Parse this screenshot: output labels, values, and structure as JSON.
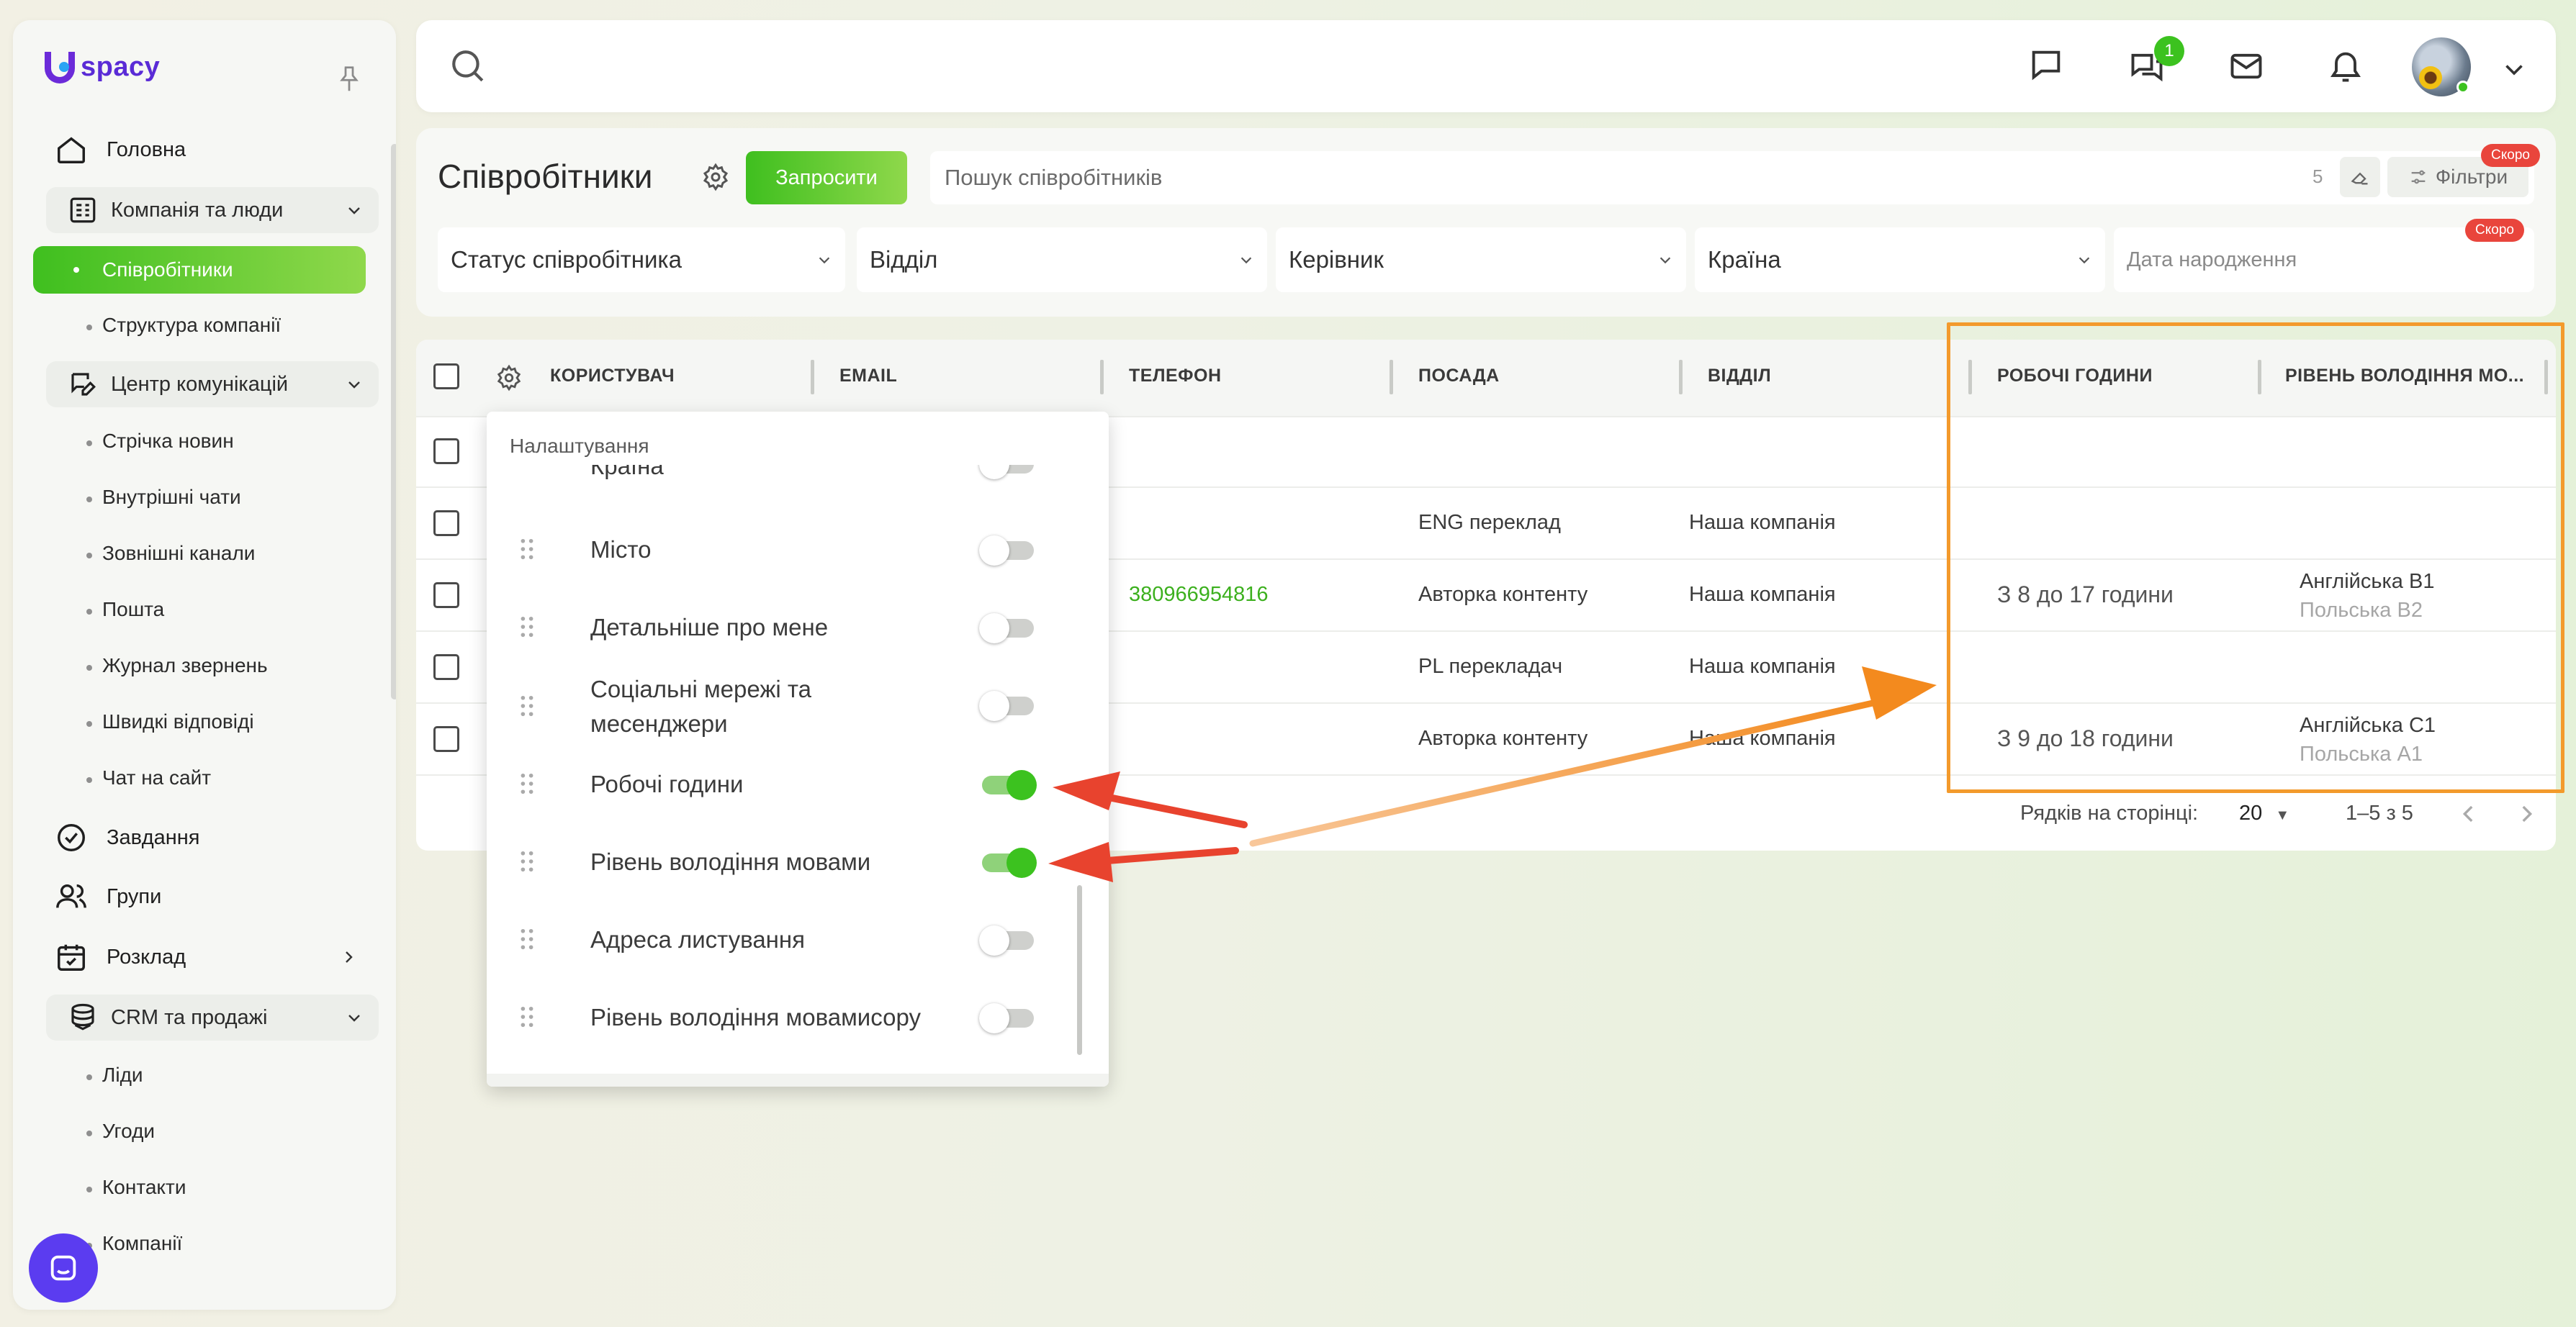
{
  "app": {
    "logo_text": "spacy",
    "brand_color": "#5a2bd6",
    "accent_color": "#3cc21f",
    "highlight_color": "#f39a2c",
    "arrow_color": "#e8432e"
  },
  "sidebar": {
    "items": [
      {
        "label": "Головна",
        "icon": "home-icon",
        "type": "item"
      },
      {
        "label": "Компанія та люди",
        "icon": "building-icon",
        "type": "group",
        "expanded": true,
        "children": [
          "Співробітники",
          "Структура компанії"
        ],
        "active_child": "Співробітники"
      },
      {
        "label": "Центр комунікацій",
        "icon": "chat-edit-icon",
        "type": "group",
        "expanded": true,
        "children": [
          "Стрічка новин",
          "Внутрішні чати",
          "Зовнішні канали",
          "Пошта",
          "Журнал звернень",
          "Швидкі відповіді",
          "Чат на сайт"
        ]
      },
      {
        "label": "Завдання",
        "icon": "check-circle-icon",
        "type": "item"
      },
      {
        "label": "Групи",
        "icon": "users-icon",
        "type": "item"
      },
      {
        "label": "Розклад",
        "icon": "calendar-icon",
        "type": "item-chevron"
      },
      {
        "label": "CRM та продажі",
        "icon": "database-icon",
        "type": "group",
        "expanded": true,
        "children": [
          "Ліди",
          "Угоди",
          "Контакти",
          "Компанії"
        ]
      }
    ]
  },
  "topbar": {
    "chat_badge": "1"
  },
  "header": {
    "title": "Співробітники",
    "invite_label": "Запросити",
    "search_placeholder": "Пошук співробітників",
    "result_count": "5",
    "filters_label": "Фільтри",
    "soon_label": "Скоро",
    "filter_selects": [
      "Статус співробітника",
      "Відділ",
      "Керівник",
      "Країна"
    ],
    "birthday_placeholder": "Дата народження"
  },
  "table": {
    "columns": [
      "КОРИСТУВАЧ",
      "EMAIL",
      "ТЕЛЕФОН",
      "ПОСАДА",
      "ВІДДІЛ",
      "РОБОЧІ ГОДИНИ",
      "РІВЕНЬ ВОЛОДІННЯ МО..."
    ],
    "rows": [
      {
        "phone": "",
        "position": "",
        "department": "",
        "hours": "",
        "lang1": "",
        "lang2": ""
      },
      {
        "phone": "",
        "position": "ENG переклад",
        "department": "Наша компанія",
        "hours": "",
        "lang1": "",
        "lang2": ""
      },
      {
        "phone": "380966954816",
        "position": "Авторка контенту",
        "department": "Наша компанія",
        "hours": "З 8 до 17 години",
        "lang1": "Англійська В1",
        "lang2": "Польська В2"
      },
      {
        "phone": "",
        "position": "PL перекладач",
        "department": "Наша компанія",
        "hours": "",
        "lang1": "",
        "lang2": ""
      },
      {
        "phone": "",
        "position": "Авторка контенту",
        "department": "Наша компанія",
        "hours": "З 9 до 18 години",
        "lang1": "Англійська С1",
        "lang2": "Польська А1"
      }
    ],
    "pager": {
      "rows_label": "Рядків на сторінці:",
      "rows_value": "20",
      "range": "1–5 з 5"
    }
  },
  "settings_popup": {
    "title": "Налаштування",
    "partial_top": "Країна",
    "items": [
      {
        "label": "Місто",
        "on": false
      },
      {
        "label": "Детальніше про мене",
        "on": false
      },
      {
        "label": "Соціальні мережі та месенджери",
        "on": false
      },
      {
        "label": "Робочі години",
        "on": true
      },
      {
        "label": "Рівень володіння мовами",
        "on": true
      },
      {
        "label": "Адреса листування",
        "on": false
      },
      {
        "label": "Рівень володіння мовамисору",
        "on": false
      }
    ]
  }
}
